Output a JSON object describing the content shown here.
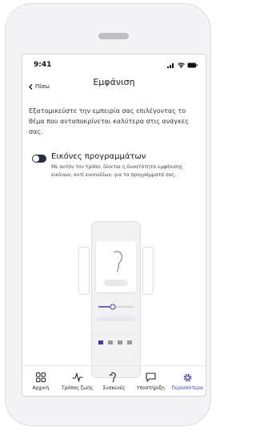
{
  "status_bar": {
    "time": "9:41"
  },
  "header": {
    "back_label": "Πίσω",
    "title": "Εμφάνιση"
  },
  "description": "Εξατομικεύστε την εμπειρία σας επιλέγοντας το θέμα που ανταποκρίνεται καλύτερα στις ανάγκες σας.",
  "option": {
    "title": "Εικόνες προγραμμάτων",
    "description": "Με αυτόν τον τρόπο, δίνεται η δυνατότητα εμφάνισης εικόνων, αντί εικονιδίων, για τα προγράμματά σας.",
    "enabled": false
  },
  "tabs": [
    {
      "label": "Αρχική",
      "icon": "grid-icon",
      "active": false
    },
    {
      "label": "Τρόπος ζωής",
      "icon": "activity-icon",
      "active": false
    },
    {
      "label": "Συσκευές",
      "icon": "hearing-aids-icon",
      "active": false
    },
    {
      "label": "Υποστήριξη",
      "icon": "chat-bubble-icon",
      "active": false
    },
    {
      "label": "Περισσότερα",
      "icon": "gear-icon",
      "active": true
    }
  ],
  "colors": {
    "accent": "#3d3ab8",
    "toggle": "#2a2d3e"
  }
}
